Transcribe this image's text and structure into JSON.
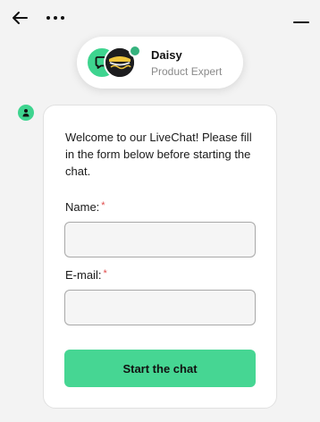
{
  "agent": {
    "name": "Daisy",
    "role": "Product Expert",
    "online_color": "#36b37e"
  },
  "icons": {
    "back": "arrow-left-icon",
    "more": "more-horizontal-icon",
    "minimize": "minimize-icon",
    "bot": "chat-bubble-icon",
    "system": "person-icon"
  },
  "form": {
    "welcome_text": "Welcome to our LiveChat! Please fill in the form below before starting the chat.",
    "name_label": "Name:",
    "email_label": "E-mail:",
    "required_mark": "*",
    "name_value": "",
    "email_value": "",
    "submit_label": "Start the chat"
  },
  "colors": {
    "accent": "#46d693",
    "required": "#e04b4b",
    "background": "#f3f3f3"
  }
}
